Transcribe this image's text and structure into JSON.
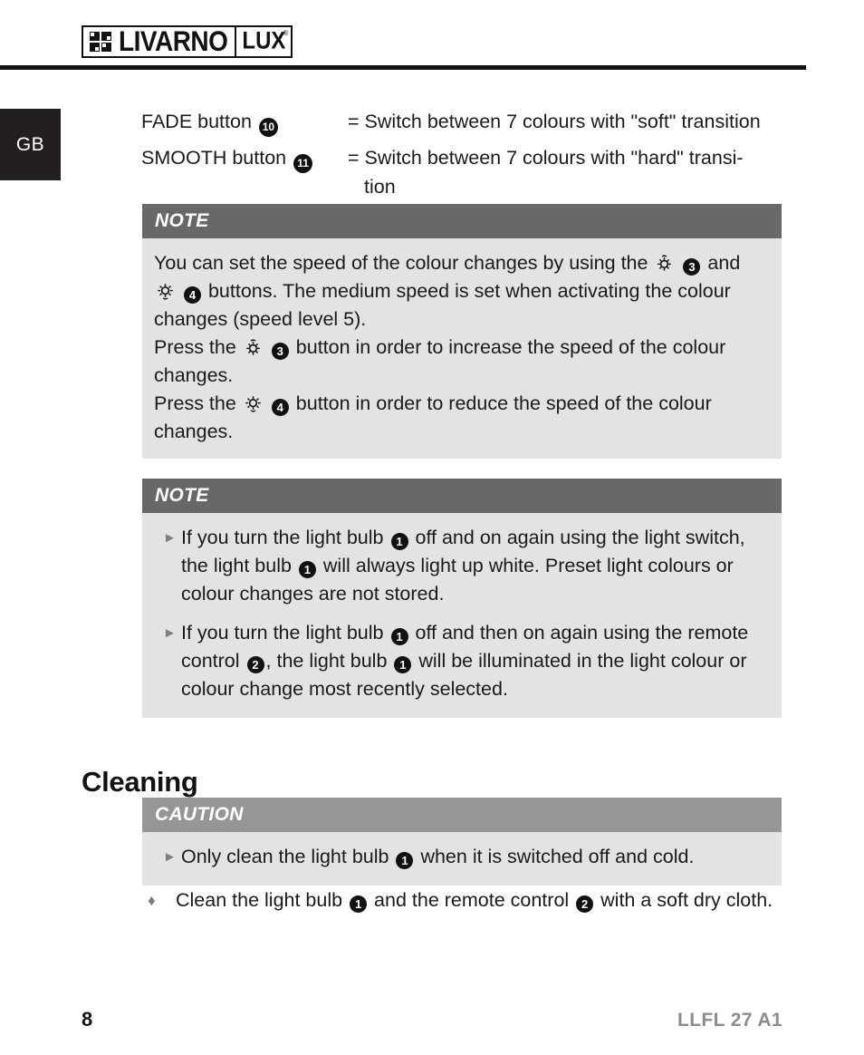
{
  "header": {
    "brand_primary": "LIVARNO",
    "brand_secondary": "LUX",
    "registered_mark": "®"
  },
  "country_tab": {
    "label": "GB"
  },
  "definitions": [
    {
      "term": "FADE button",
      "term_ref": "10",
      "separator": "=",
      "definition": "Switch between 7 colours with \"soft\" transition",
      "definition_continued": ""
    },
    {
      "term": "SMOOTH button",
      "term_ref": "11",
      "separator": "=",
      "definition": "Switch between 7 colours with \"hard\" transi-",
      "definition_continued": "tion"
    }
  ],
  "note_box_1": {
    "title": "NOTE",
    "paragraph_1_part_1": "You can set the speed of the colour changes by using the",
    "paragraph_1_ref_1": "3",
    "paragraph_1_part_2": "and",
    "paragraph_1_ref_2": "4",
    "paragraph_1_part_3": "buttons. The medium speed is set when activating the colour changes (speed level 5).",
    "paragraph_2_part_1": "Press the",
    "paragraph_2_ref": "3",
    "paragraph_2_part_2": "button in order to increase the speed of the colour changes.",
    "paragraph_3_part_1": "Press the",
    "paragraph_3_ref": "4",
    "paragraph_3_part_2": "button in order to reduce the speed of the colour changes."
  },
  "note_box_2": {
    "title": "NOTE",
    "bullet_1": {
      "part_1": "If you turn the light bulb",
      "ref_1": "1",
      "part_2": "off and on again using the light switch, the light bulb",
      "ref_2": "1",
      "part_3": "will always light up white. Preset light colours or colour changes are not stored."
    },
    "bullet_2": {
      "part_1": "If you turn the light bulb",
      "ref_1": "1",
      "part_2": "off and then on again using the remote control",
      "ref_2": "2",
      "part_3": ", the light bulb",
      "ref_3": "1",
      "part_4": "will be illuminated in the light colour or colour change most recently selected."
    }
  },
  "section_heading": "Cleaning",
  "caution_box": {
    "title": "CAUTION",
    "bullet_1": {
      "part_1": "Only clean the light bulb",
      "ref_1": "1",
      "part_2": "when it is switched off and cold."
    }
  },
  "final_instruction": {
    "part_1": "Clean the light bulb",
    "ref_1": "1",
    "part_2": "and the remote control",
    "ref_2": "2",
    "part_3": "with a soft dry cloth."
  },
  "footer": {
    "page_number": "8",
    "document_code": "LLFL 27 A1"
  },
  "icons": {
    "brightness_up": "sun-small-icon",
    "brightness_down": "sun-large-icon",
    "bullet_triangle": "►",
    "bullet_diamond": "♦"
  },
  "colors": {
    "note_bar": "#66686a",
    "caution_bar": "#949698",
    "box_body": "#e2e3e4",
    "tab_background": "#231f20",
    "footer_code": "#8a8c8e"
  }
}
